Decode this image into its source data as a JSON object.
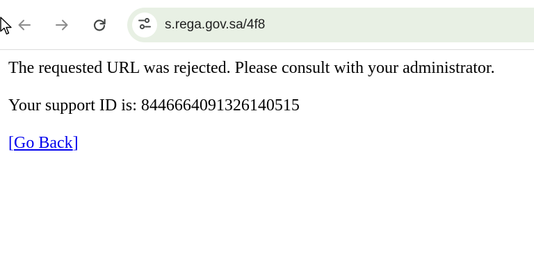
{
  "browser": {
    "address_bar": {
      "url": "s.rega.gov.sa/4f8",
      "site_info_icon": "tune-icon"
    },
    "nav_icons": [
      "arrow-back-icon",
      "arrow-forward-icon",
      "reload-icon"
    ]
  },
  "page": {
    "message": "The requested URL was rejected. Please consult with your administrator.",
    "support_id_text": "Your support ID is: 8446664091326140515",
    "link_open_bracket": "[",
    "link_label": "Go Back",
    "link_close_bracket": "]"
  },
  "colors": {
    "link": "#0000ee",
    "omnibox_background": "#e8f0e4",
    "nav_icon_disabled": "#8c8c8c",
    "nav_icon_active": "#444746"
  }
}
